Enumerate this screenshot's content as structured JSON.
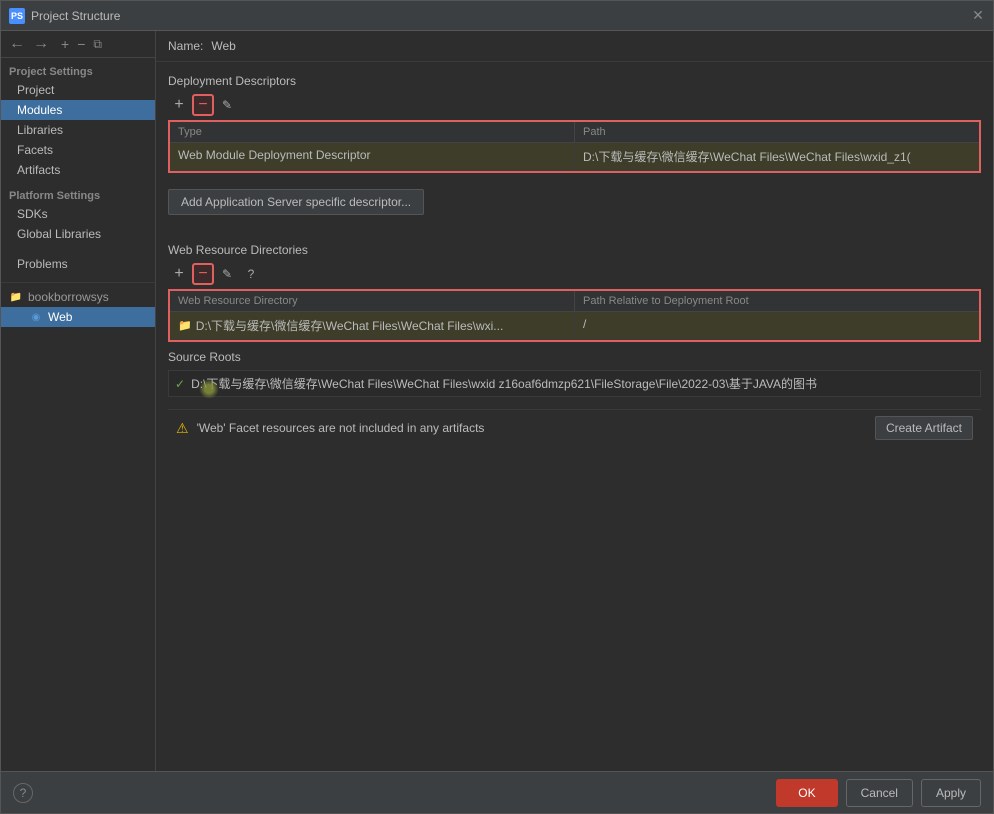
{
  "dialog": {
    "title": "Project Structure",
    "title_icon": "PS"
  },
  "sidebar": {
    "nav_back": "←",
    "nav_forward": "→",
    "add_btn": "+",
    "remove_btn": "−",
    "copy_btn": "⧉",
    "project_settings_label": "Project Settings",
    "items": [
      {
        "id": "project",
        "label": "Project",
        "indent": 1
      },
      {
        "id": "modules",
        "label": "Modules",
        "indent": 1,
        "selected": true
      },
      {
        "id": "libraries",
        "label": "Libraries",
        "indent": 1
      },
      {
        "id": "facets",
        "label": "Facets",
        "indent": 1
      },
      {
        "id": "artifacts",
        "label": "Artifacts",
        "indent": 1
      }
    ],
    "platform_settings_label": "Platform Settings",
    "platform_items": [
      {
        "id": "sdks",
        "label": "SDKs",
        "indent": 1
      },
      {
        "id": "global-libraries",
        "label": "Global Libraries",
        "indent": 1
      }
    ],
    "other_items": [
      {
        "id": "problems",
        "label": "Problems",
        "indent": 0
      }
    ],
    "tree_items": [
      {
        "id": "bookborrowsys",
        "label": "bookborrowsys",
        "icon": "folder",
        "indent": 0
      },
      {
        "id": "web",
        "label": "Web",
        "icon": "module",
        "indent": 1,
        "selected": true
      }
    ]
  },
  "right_panel": {
    "name_label": "Name:",
    "name_value": "Web",
    "deployment_descriptors_label": "Deployment Descriptors",
    "descriptor_table": {
      "columns": [
        "Type",
        "Path"
      ],
      "rows": [
        {
          "type": "Web Module Deployment Descriptor",
          "path": "D:\\下载与缓存\\微信缓存\\WeChat Files\\WeChat Files\\wxid_z1("
        }
      ]
    },
    "add_descriptor_btn": "Add Application Server specific descriptor...",
    "web_resource_label": "Web Resource Directories",
    "web_resource_table": {
      "columns": [
        "Web Resource Directory",
        "Path Relative to Deployment Root"
      ],
      "rows": [
        {
          "dir": "D:\\下载与缓存\\微信缓存\\WeChat Files\\WeChat Files\\wxi...",
          "path": "/"
        }
      ]
    },
    "source_roots_label": "Source Roots",
    "source_roots": [
      {
        "checked": true,
        "path": "D:\\下载与缓存\\微信缓存\\WeChat Files\\WeChat Files\\wxid z16oaf6dmzp621\\FileStorage\\File\\2022-03\\基于JAVA的图书"
      }
    ],
    "warning_text": "'Web' Facet resources are not included in any artifacts",
    "create_artifact_btn": "Create Artifact"
  },
  "bottom_bar": {
    "help_icon": "?",
    "ok_label": "OK",
    "cancel_label": "Cancel",
    "apply_label": "Apply"
  }
}
